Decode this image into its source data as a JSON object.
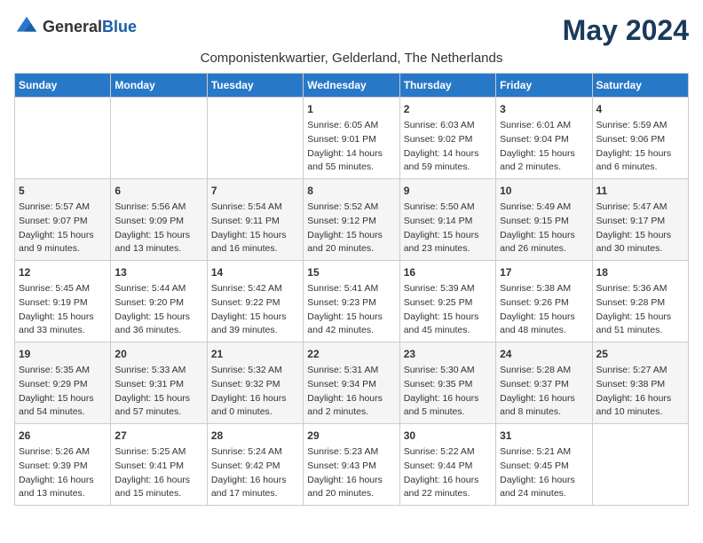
{
  "logo": {
    "general": "General",
    "blue": "Blue"
  },
  "title": "May 2024",
  "subtitle": "Componistenkwartier, Gelderland, The Netherlands",
  "columns": [
    "Sunday",
    "Monday",
    "Tuesday",
    "Wednesday",
    "Thursday",
    "Friday",
    "Saturday"
  ],
  "weeks": [
    [
      {
        "day": "",
        "info": ""
      },
      {
        "day": "",
        "info": ""
      },
      {
        "day": "",
        "info": ""
      },
      {
        "day": "1",
        "info": "Sunrise: 6:05 AM\nSunset: 9:01 PM\nDaylight: 14 hours\nand 55 minutes."
      },
      {
        "day": "2",
        "info": "Sunrise: 6:03 AM\nSunset: 9:02 PM\nDaylight: 14 hours\nand 59 minutes."
      },
      {
        "day": "3",
        "info": "Sunrise: 6:01 AM\nSunset: 9:04 PM\nDaylight: 15 hours\nand 2 minutes."
      },
      {
        "day": "4",
        "info": "Sunrise: 5:59 AM\nSunset: 9:06 PM\nDaylight: 15 hours\nand 6 minutes."
      }
    ],
    [
      {
        "day": "5",
        "info": "Sunrise: 5:57 AM\nSunset: 9:07 PM\nDaylight: 15 hours\nand 9 minutes."
      },
      {
        "day": "6",
        "info": "Sunrise: 5:56 AM\nSunset: 9:09 PM\nDaylight: 15 hours\nand 13 minutes."
      },
      {
        "day": "7",
        "info": "Sunrise: 5:54 AM\nSunset: 9:11 PM\nDaylight: 15 hours\nand 16 minutes."
      },
      {
        "day": "8",
        "info": "Sunrise: 5:52 AM\nSunset: 9:12 PM\nDaylight: 15 hours\nand 20 minutes."
      },
      {
        "day": "9",
        "info": "Sunrise: 5:50 AM\nSunset: 9:14 PM\nDaylight: 15 hours\nand 23 minutes."
      },
      {
        "day": "10",
        "info": "Sunrise: 5:49 AM\nSunset: 9:15 PM\nDaylight: 15 hours\nand 26 minutes."
      },
      {
        "day": "11",
        "info": "Sunrise: 5:47 AM\nSunset: 9:17 PM\nDaylight: 15 hours\nand 30 minutes."
      }
    ],
    [
      {
        "day": "12",
        "info": "Sunrise: 5:45 AM\nSunset: 9:19 PM\nDaylight: 15 hours\nand 33 minutes."
      },
      {
        "day": "13",
        "info": "Sunrise: 5:44 AM\nSunset: 9:20 PM\nDaylight: 15 hours\nand 36 minutes."
      },
      {
        "day": "14",
        "info": "Sunrise: 5:42 AM\nSunset: 9:22 PM\nDaylight: 15 hours\nand 39 minutes."
      },
      {
        "day": "15",
        "info": "Sunrise: 5:41 AM\nSunset: 9:23 PM\nDaylight: 15 hours\nand 42 minutes."
      },
      {
        "day": "16",
        "info": "Sunrise: 5:39 AM\nSunset: 9:25 PM\nDaylight: 15 hours\nand 45 minutes."
      },
      {
        "day": "17",
        "info": "Sunrise: 5:38 AM\nSunset: 9:26 PM\nDaylight: 15 hours\nand 48 minutes."
      },
      {
        "day": "18",
        "info": "Sunrise: 5:36 AM\nSunset: 9:28 PM\nDaylight: 15 hours\nand 51 minutes."
      }
    ],
    [
      {
        "day": "19",
        "info": "Sunrise: 5:35 AM\nSunset: 9:29 PM\nDaylight: 15 hours\nand 54 minutes."
      },
      {
        "day": "20",
        "info": "Sunrise: 5:33 AM\nSunset: 9:31 PM\nDaylight: 15 hours\nand 57 minutes."
      },
      {
        "day": "21",
        "info": "Sunrise: 5:32 AM\nSunset: 9:32 PM\nDaylight: 16 hours\nand 0 minutes."
      },
      {
        "day": "22",
        "info": "Sunrise: 5:31 AM\nSunset: 9:34 PM\nDaylight: 16 hours\nand 2 minutes."
      },
      {
        "day": "23",
        "info": "Sunrise: 5:30 AM\nSunset: 9:35 PM\nDaylight: 16 hours\nand 5 minutes."
      },
      {
        "day": "24",
        "info": "Sunrise: 5:28 AM\nSunset: 9:37 PM\nDaylight: 16 hours\nand 8 minutes."
      },
      {
        "day": "25",
        "info": "Sunrise: 5:27 AM\nSunset: 9:38 PM\nDaylight: 16 hours\nand 10 minutes."
      }
    ],
    [
      {
        "day": "26",
        "info": "Sunrise: 5:26 AM\nSunset: 9:39 PM\nDaylight: 16 hours\nand 13 minutes."
      },
      {
        "day": "27",
        "info": "Sunrise: 5:25 AM\nSunset: 9:41 PM\nDaylight: 16 hours\nand 15 minutes."
      },
      {
        "day": "28",
        "info": "Sunrise: 5:24 AM\nSunset: 9:42 PM\nDaylight: 16 hours\nand 17 minutes."
      },
      {
        "day": "29",
        "info": "Sunrise: 5:23 AM\nSunset: 9:43 PM\nDaylight: 16 hours\nand 20 minutes."
      },
      {
        "day": "30",
        "info": "Sunrise: 5:22 AM\nSunset: 9:44 PM\nDaylight: 16 hours\nand 22 minutes."
      },
      {
        "day": "31",
        "info": "Sunrise: 5:21 AM\nSunset: 9:45 PM\nDaylight: 16 hours\nand 24 minutes."
      },
      {
        "day": "",
        "info": ""
      }
    ]
  ]
}
